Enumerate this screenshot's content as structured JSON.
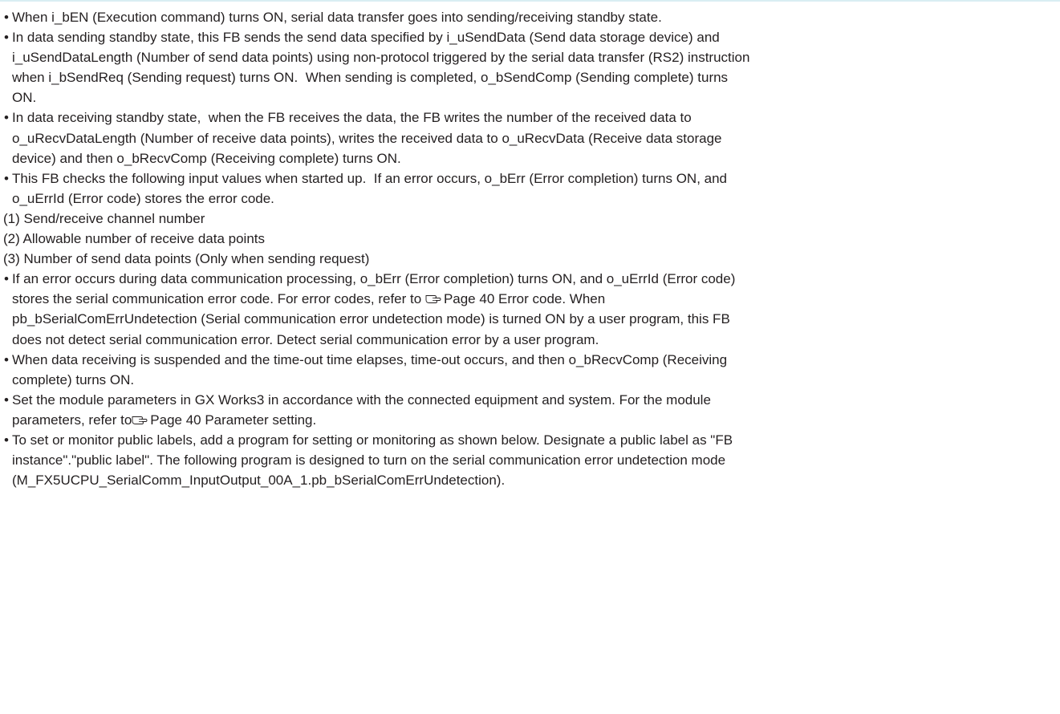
{
  "bullet_char": "•",
  "icons": {
    "reference": "pointing-hand-icon"
  },
  "lines": {
    "l01": "When i_bEN (Execution command) turns ON, serial data transfer goes into sending/receiving standby state.",
    "l02": "In data sending standby state, this FB sends the send data specified by i_uSendData (Send data storage device) and",
    "l03": "i_uSendDataLength (Number of send data points) using non-protocol triggered by the serial data transfer (RS2) instruction",
    "l04": "when i_bSendReq (Sending request) turns ON.  When sending is completed, o_bSendComp (Sending complete) turns",
    "l05": "ON.",
    "l06": "In data receiving standby state,  when the FB receives the data, the FB writes the number of the received data to",
    "l07": "o_uRecvDataLength (Number of receive data points), writes the received data to o_uRecvData (Receive data storage",
    "l08": "device) and then o_bRecvComp (Receiving complete) turns ON.",
    "l09": "This FB checks the following input values when started up.  If an error occurs, o_bErr (Error completion) turns ON, and",
    "l10": "o_uErrId (Error code) stores the error code.",
    "l11": "(1) Send/receive channel number",
    "l12": "(2) Allowable number of receive data points",
    "l13": "(3) Number of send data points (Only when sending request)",
    "l14": "If an error occurs during data communication processing, o_bErr (Error completion) turns ON, and o_uErrId (Error code)",
    "l15a": "stores the serial communication error code. For error codes, refer to ",
    "l15b": "Page 40 Error code. When",
    "l16": "pb_bSerialComErrUndetection (Serial communication error undetection mode) is turned ON by a user program, this FB",
    "l17": "does not detect serial communication error. Detect serial communication error by a user program.",
    "l18": "When data receiving is suspended and the time-out time elapses, time-out occurs, and then o_bRecvComp (Receiving",
    "l19": "complete) turns ON.",
    "l20": "Set the module parameters in GX Works3 in accordance with the connected equipment and system. For the module",
    "l21a": "parameters, refer to",
    "l21b": "Page 40 Parameter setting.",
    "l22": "To set or monitor public labels, add a program for setting or monitoring as shown below. Designate a public label as \"FB",
    "l23": "instance\".\"public label\". The following program is designed to turn on the serial communication error undetection mode",
    "l24": "(M_FX5UCPU_SerialComm_InputOutput_00A_1.pb_bSerialComErrUndetection)."
  }
}
